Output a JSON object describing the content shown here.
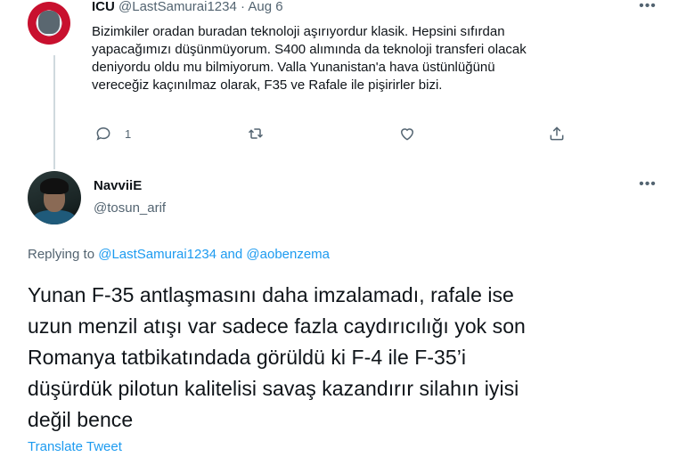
{
  "parent_tweet": {
    "display_name": "ICU",
    "handle": "@LastSamurai1234",
    "separator": "·",
    "date": "Aug 6",
    "text_lines": [
      "Bizimkiler oradan buradan teknoloji aşırıyordur klasik. Hepsini sıfırdan",
      "yapacağımızı düşünmüyorum. S400 alımında da teknoloji transferi olacak",
      "deniyordu oldu mu bilmiyorum. Valla Yunanistan'a hava üstünlüğünü",
      "vereceğiz kaçınılmaz olarak, F35 ve Rafale ile pişirirler bizi."
    ],
    "reply_count": "1",
    "more_label": "•••"
  },
  "main_tweet": {
    "display_name": "NavviiE",
    "handle": "@tosun_arif",
    "more_label": "•••",
    "replying_prefix": "Replying to",
    "replying_user1": "@LastSamurai1234",
    "replying_and": "and",
    "replying_user2": "@aobenzema",
    "text_lines": [
      "Yunan F-35 antlaşmasını daha imzalamadı, rafale ise",
      "uzun menzil atışı var sadece fazla caydırıcılığı yok son",
      "Romanya tatbikatındada görüldü ki F-4 ile F-35’i",
      "düşürdük pilotun kalitelisi savaş kazandırır silahın iyisi",
      "değil bence"
    ],
    "translate_label": "Translate Tweet"
  },
  "colors": {
    "text": "#0f1419",
    "secondary": "#536471",
    "link": "#1d9bf0",
    "thread_line": "#cfd9de"
  }
}
